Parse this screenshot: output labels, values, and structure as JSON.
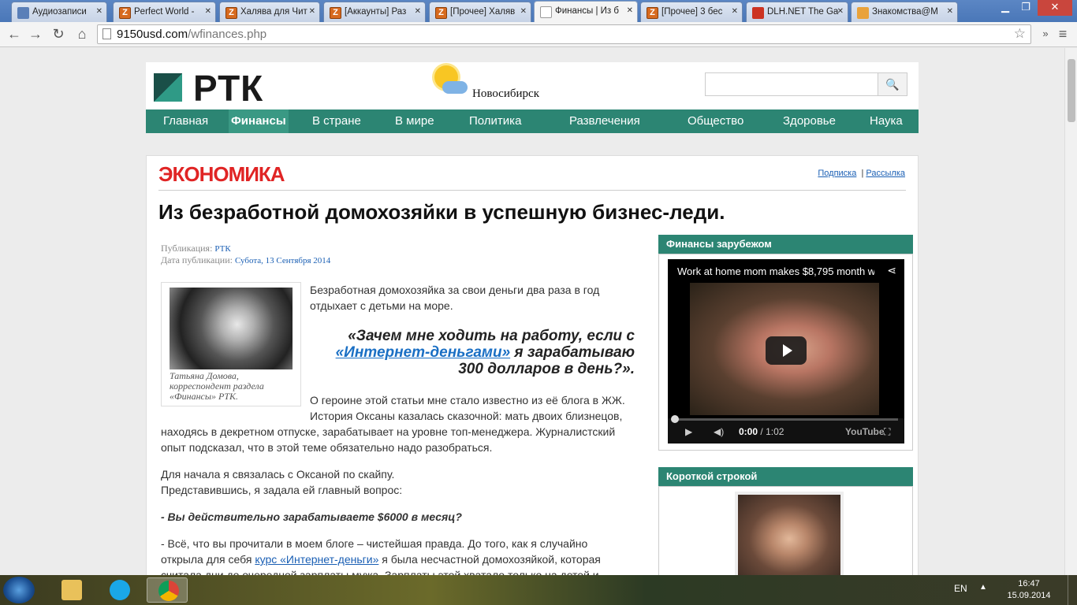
{
  "browser": {
    "tabs": [
      {
        "title": "Аудиозаписи",
        "icon": "play-favicon-icon"
      },
      {
        "title": "Perfect World -",
        "icon": "z-favicon-icon"
      },
      {
        "title": "Халява для Чит",
        "icon": "z-favicon-icon"
      },
      {
        "title": "[Аккаунты] Раз",
        "icon": "z-favicon-icon"
      },
      {
        "title": "[Прочее] Халяв",
        "icon": "z-favicon-icon"
      },
      {
        "title": "Финансы | Из б",
        "icon": "document-favicon-icon",
        "active": true
      },
      {
        "title": "[Прочее] 3 бес",
        "icon": "z-favicon-icon"
      },
      {
        "title": "DLH.NET The Ga",
        "icon": "dlh-favicon-icon"
      },
      {
        "title": "Знакомства@M",
        "icon": "heart-favicon-icon"
      }
    ],
    "url_domain": "9150usd.com",
    "url_path": "/wfinances.php"
  },
  "site": {
    "logo": "РТК",
    "city": "Новосибирск",
    "search_placeholder": "",
    "nav": [
      "Главная",
      "Финансы",
      "В стране",
      "В мире",
      "Политика",
      "Развлечения",
      "Общество",
      "Здоровье",
      "Наука"
    ],
    "nav_active": "Финансы",
    "accent": "#2c8573"
  },
  "article": {
    "section": "ЭКОНОМИКА",
    "link_subscribe": "Подписка",
    "link_separator": "|",
    "link_mailing": "Рассылка",
    "headline": "Из безработной домохозяйки в успешную бизнес-леди.",
    "pub_label": "Публикация:",
    "pub_value": "РТК",
    "date_label": "Дата публикации:",
    "date_value": "Субота, 13 Сентября 2014",
    "photo_caption": "Татьяна Домова, корреспондент раздела «Финансы» РТК.",
    "p1": "Безработная домохозяйка за свои деньги два раза в год отдыхает с детьми на море.",
    "quote_a": "«Зачем мне ходить на работу, если с",
    "quote_link": "«Интернет-деньгами»",
    "quote_b": " я зарабатываю",
    "quote_c": "300 долларов в день?».",
    "p2a": "О героине этой статьи мне стало известно из её блога в ЖЖ.",
    "p2b": "История Оксаны казалась сказочной: мать двоих близнецов,",
    "p2c": "находясь в декретном отпуске, зарабатывает на уровне топ-менеджера. Журналистский",
    "p2d": "опыт подсказал, что в этой теме обязательно надо разобраться.",
    "p3a": "Для начала я связалась с Оксаной по скайпу.",
    "p3b": "Представившись, я задала ей главный вопрос:",
    "q1": "- Вы действительно зарабатываете $6000 в месяц?",
    "p4a": "- Всё, что вы прочитали в моем блоге – чистейшая правда. До того, как я случайно",
    "p4b_pre": "открыла для себя ",
    "p4b_link": "курс «Интернет-деньги»",
    "p4b_post": " я была несчастной домохозяйкой, которая",
    "p4c": "считала дни до очередной зарплаты мужа. Зарплаты этой хватало только на детей и"
  },
  "sidebar": {
    "box1_title": "Финансы зарубежом",
    "video_title": "Work at home mom makes $8,795 month w",
    "video_time": "0:00",
    "video_sep": "/",
    "video_duration": "1:02",
    "video_brand": "YouTube",
    "box2_title": "Короткой строкой"
  },
  "taskbar": {
    "lang": "EN",
    "time": "16:47",
    "date": "15.09.2014"
  }
}
